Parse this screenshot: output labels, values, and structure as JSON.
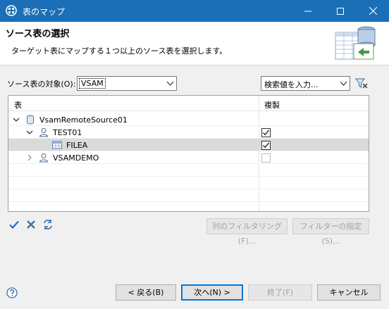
{
  "window": {
    "title": "表のマップ"
  },
  "header": {
    "title": "ソース表の選択",
    "description": "ターゲット表にマップする１つ以上のソース表を選択します。"
  },
  "source": {
    "label": "ソース表の対象(O):",
    "selected": "VSAM",
    "search_placeholder": "検索値を入力..."
  },
  "table": {
    "columns": [
      "表",
      "複製"
    ],
    "rows": [
      {
        "name": "VsamRemoteSource01",
        "level": 0,
        "expanded": true,
        "icon": "database-icon",
        "checkbox": null
      },
      {
        "name": "TEST01",
        "level": 1,
        "expanded": true,
        "icon": "schema-user-icon",
        "checkbox": "checked"
      },
      {
        "name": "FILEA",
        "level": 2,
        "expanded": null,
        "icon": "table-icon",
        "checkbox": "checked",
        "selected": true
      },
      {
        "name": "VSAMDEMO",
        "level": 1,
        "expanded": false,
        "icon": "schema-user-icon",
        "checkbox": "disabled"
      }
    ]
  },
  "toolbar": {
    "column_filter_label": "列のフィルタリング(F)...",
    "filter_spec_label": "フィルターの指定(S)..."
  },
  "footer": {
    "back_label": "< 戻る(B)",
    "next_label": "次へ(N) >",
    "finish_label": "終了(F)",
    "cancel_label": "キャンセル"
  },
  "colors": {
    "titlebar": "#1a6fb7",
    "accent": "#0078d7",
    "checkmark": "#1e6fc2"
  }
}
